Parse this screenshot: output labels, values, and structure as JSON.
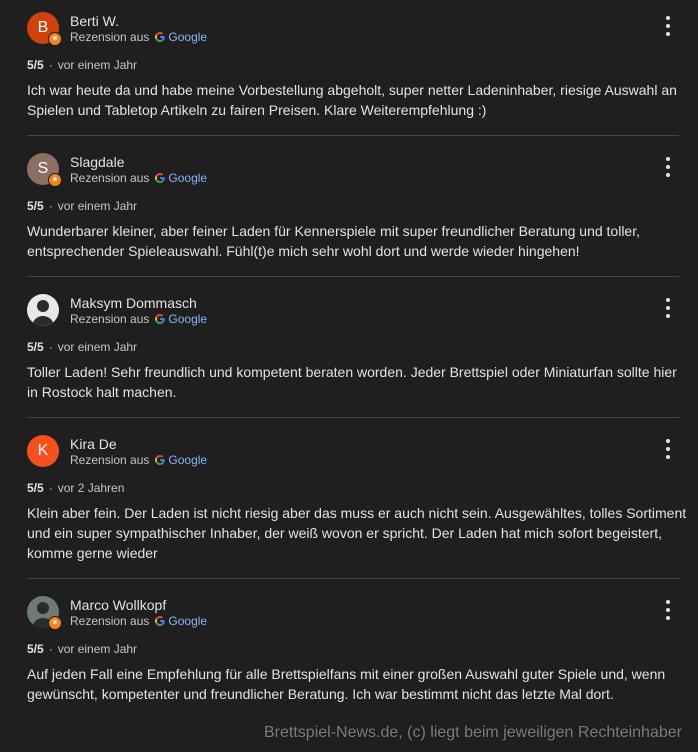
{
  "colors": {
    "background": "#1f1f1f",
    "text": "#e3e3e3",
    "muted": "#c4c7c5",
    "link": "#8ab4f8",
    "badge": "#f58220"
  },
  "reviews": [
    {
      "author": "Berti W.",
      "avatar_letter": "B",
      "avatar_color": "#d1410c",
      "source_prefix": "Rezension aus",
      "source": "Google",
      "rating": "5/5",
      "time": "vor einem Jahr",
      "text": "Ich war heute da und habe meine Vorbestellung abgeholt, super netter Ladeninhaber, riesige Auswahl an Spielen und Tabletop Artikeln zu fairen Preisen. Klare Weiterempfehlung :)"
    },
    {
      "author": "Slagdale",
      "avatar_letter": "S",
      "avatar_color": "#8d6e63",
      "source_prefix": "Rezension aus",
      "source": "Google",
      "rating": "5/5",
      "time": "vor einem Jahr",
      "text": "Wunderbarer kleiner, aber feiner Laden für Kennerspiele mit super freundlicher Beratung und toller, entsprechender Spieleauswahl. Fühl(t)e mich sehr wohl dort und werde wieder hingehen!"
    },
    {
      "author": "Maksym Dommasch",
      "avatar_letter": "",
      "avatar_color": "#e8e8e8",
      "source_prefix": "Rezension aus",
      "source": "Google",
      "rating": "5/5",
      "time": "vor einem Jahr",
      "text": "Toller Laden! Sehr freundlich und kompetent beraten worden. Jeder Brettspiel oder Miniaturfan sollte hier in Rostock halt machen."
    },
    {
      "author": "Kira De",
      "avatar_letter": "K",
      "avatar_color": "#f4511e",
      "source_prefix": "Rezension aus",
      "source": "Google",
      "rating": "5/5",
      "time": "vor 2 Jahren",
      "text": "Klein aber fein. Der Laden ist nicht riesig aber das muss er auch nicht sein. Ausgewähltes, tolles Sortiment und ein super sympathischer Inhaber, der weiß wovon er spricht. Der Laden hat mich sofort begeistert, komme gerne wieder"
    },
    {
      "author": "Marco Wollkopf",
      "avatar_letter": "",
      "avatar_color": "#6d7b70",
      "source_prefix": "Rezension aus",
      "source": "Google",
      "rating": "5/5",
      "time": "vor einem Jahr",
      "text": "Auf jeden Fall eine Empfehlung für alle Brettspielfans mit einer großen Auswahl guter Spiele und, wenn gewünscht, kompetenter und freundlicher Beratung. Ich war bestimmt nicht das letzte Mal dort."
    }
  ],
  "watermark": "Brettspiel-News.de, (c) liegt beim jeweiligen Rechteinhaber"
}
